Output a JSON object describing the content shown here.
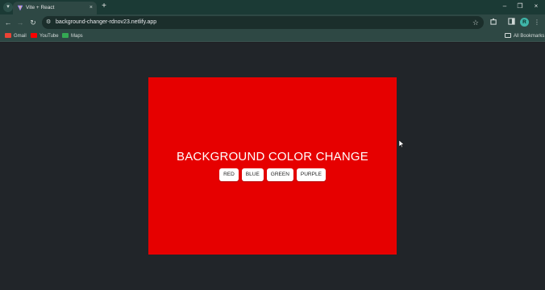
{
  "browser": {
    "tab": {
      "title": "Vite + React",
      "close": "×"
    },
    "new_tab": "+",
    "window_controls": {
      "minimize": "–",
      "maximize": "❐",
      "close": "×"
    },
    "toolbar": {
      "back": "←",
      "forward": "→",
      "reload": "↻",
      "url": "background-changer-rdnov23.netlify.app",
      "site_info": "⚙",
      "bookmark_star": "☆",
      "profile_initial": "R"
    },
    "bookmarks": [
      {
        "label": "Gmail",
        "color": "#ea4335"
      },
      {
        "label": "YouTube",
        "color": "#ff0000"
      },
      {
        "label": "Maps",
        "color": "#34a853"
      }
    ],
    "all_bookmarks": "All Bookmarks"
  },
  "app": {
    "title": "BACKGROUND COLOR CHANGE",
    "background": "#e60000",
    "buttons": [
      "RED",
      "BLUE",
      "GREEN",
      "PURPLE"
    ]
  },
  "colors": {
    "tabstrip": "#1b3a35",
    "toolbar": "#2e4844",
    "page_bg": "#212529"
  }
}
